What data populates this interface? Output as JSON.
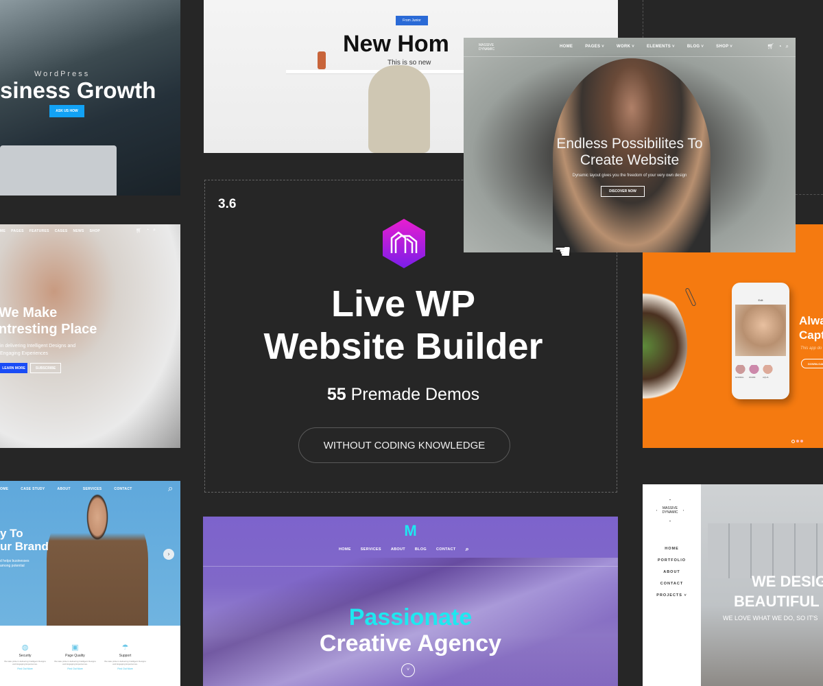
{
  "center": {
    "version": "3.6",
    "title_line1": "Live WP",
    "title_line2": "Website Builder",
    "demos_count": "55",
    "demos_label": "Premade Demos",
    "cta_label": "WITHOUT CODING KNOWLEDGE",
    "logo_gradient": [
      "#e81ed0",
      "#7a1ee8"
    ]
  },
  "panel_business": {
    "eyebrow": "WordPress",
    "title": "siness Growth",
    "button": "ASK US HOW",
    "button_color": "#12a2f5"
  },
  "panel_new_home": {
    "badge": "From Junior",
    "title": "New Hom",
    "subtitle": "This is so new",
    "badge_color": "#2a6ad6"
  },
  "panel_massive": {
    "logo": "MASSIVE DYNAMIC",
    "nav": [
      "HOME",
      "PAGES ˅",
      "WORK ˅",
      "ELEMENTS ˅",
      "BLOG ˅",
      "SHOP ˅"
    ],
    "icons": [
      "cart-icon",
      "bell-icon",
      "search-icon"
    ],
    "title_line1": "Endless Possibilites To",
    "title_line2": "Create Website",
    "subtitle": "Dynamic layout gives you the freedom of your very own design",
    "button": "DISCOVER NOW"
  },
  "panel_interesting": {
    "nav": [
      "ME",
      "PAGES",
      "FEATURES",
      "CASES",
      "NEWS",
      "SHOP"
    ],
    "title_line1": "We Make",
    "title_line2": "ntresting Place",
    "text_line1": "in delivering Intelligent Designs and",
    "text_line2": "Engaging Experiences",
    "button_primary": "LEARN MORE",
    "button_secondary": "SUBSCRIBE",
    "accent": "#1a4cf5"
  },
  "panel_app": {
    "title_line1": "Alwa",
    "title_line2": "Capt",
    "text": "This app do",
    "button": "DOWNLOAD",
    "phone_header": "Edit",
    "filters": [
      "NORMAL",
      "WARM",
      "AQUA"
    ],
    "bg": "#f57a10"
  },
  "panel_brand": {
    "nav": [
      "OME",
      "CASE STUDY",
      "ABOUT",
      "SERVICES",
      "CONTACT"
    ],
    "title_line1": "y To",
    "title_line2": "ur Brand",
    "text_line1": "d helps businesses",
    "text_line2": "among potential",
    "features": [
      {
        "icon": "globe-icon",
        "title": "Security",
        "link": "Find Out More"
      },
      {
        "icon": "layout-icon",
        "title": "Page Quality",
        "link": "Find Out More"
      },
      {
        "icon": "umbrella-icon",
        "title": "Support",
        "link": "Find Out More"
      }
    ],
    "feature_text": "We take pride in delivering Intelligent Designs and Engaging Experiences."
  },
  "panel_agency": {
    "logo": "M",
    "nav": [
      "HOME",
      "SERVICES",
      "ABOUT",
      "BLOG",
      "CONTACT"
    ],
    "title_line1": "Passionate",
    "title_line2": "Creative Agency",
    "accent": "#1ee8f0"
  },
  "panel_design": {
    "logo": "MASSIVE DYNAMIC",
    "nav": [
      "HOME",
      "PORTFOLIO",
      "ABOUT",
      "CONTACT",
      "PROJECTS ˅"
    ],
    "title_line1": "WE DESIG",
    "title_line2": "BEAUTIFUL",
    "subtitle": "WE LOVE WHAT WE DO, SO IT'S"
  }
}
